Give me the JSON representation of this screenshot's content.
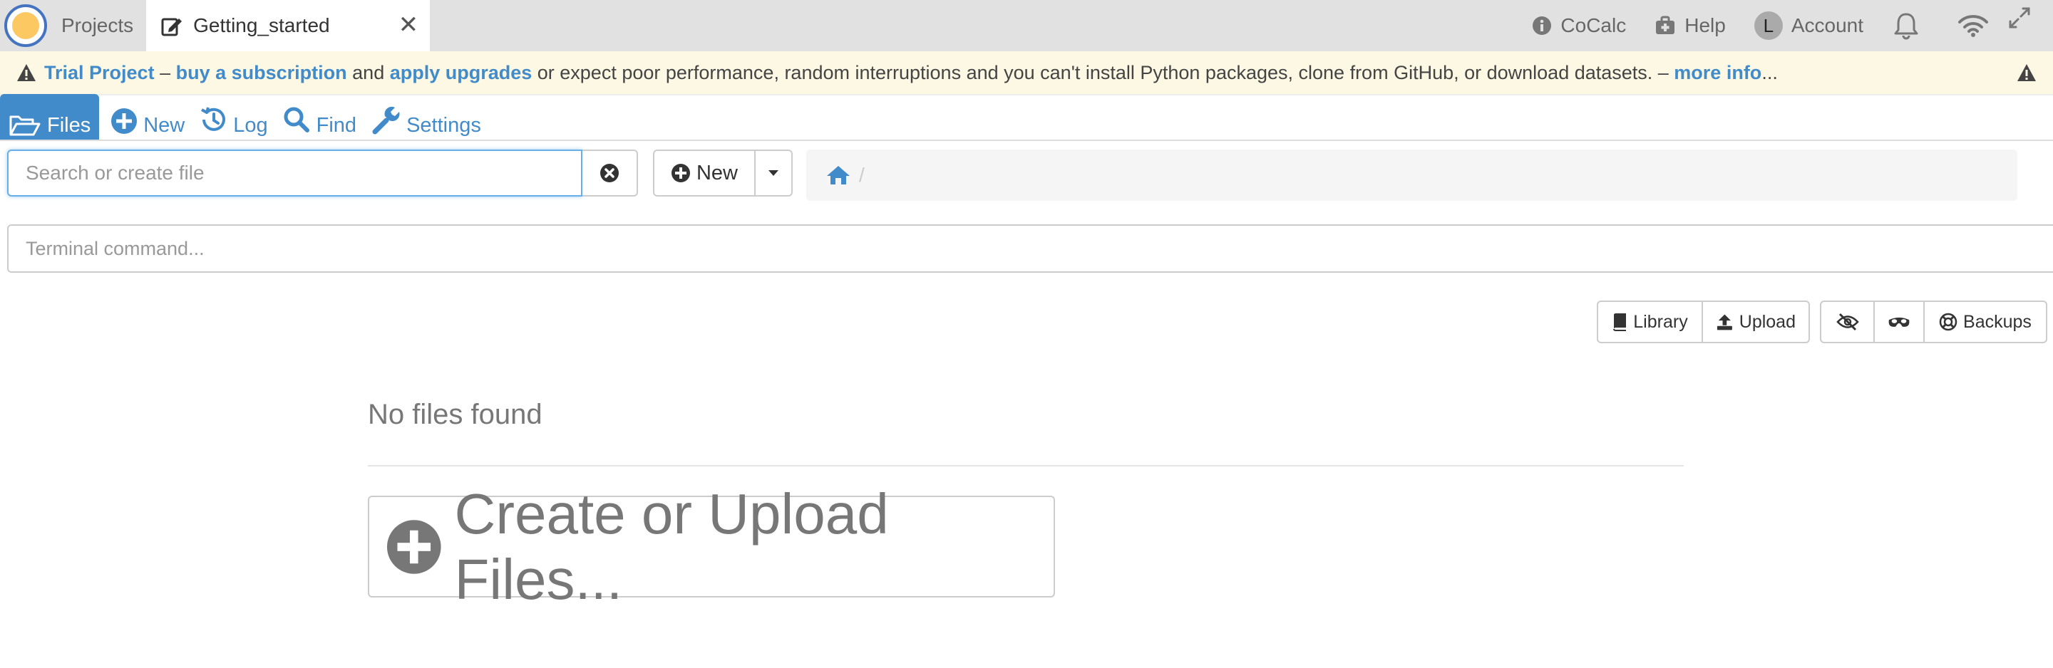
{
  "topbar": {
    "projects_label": "Projects",
    "active_tab_label": "Getting_started",
    "close_glyph": "✕",
    "cocalc_label": "CoCalc",
    "help_label": "Help",
    "account_initial": "L",
    "account_label": "Account"
  },
  "banner": {
    "trial": "Trial Project",
    "dash1": " – ",
    "buy": "buy a subscription",
    "and": " and ",
    "apply": "apply upgrades",
    "rest": " or expect poor performance, random interruptions and you can't install Python packages, clone from GitHub, or download datasets. – ",
    "more": "more info",
    "ellipsis": "..."
  },
  "nav": {
    "files": "Files",
    "new": "New",
    "log": "Log",
    "find": "Find",
    "settings": "Settings"
  },
  "search": {
    "placeholder": "Search or create file",
    "value": ""
  },
  "new_button": {
    "label": "New"
  },
  "breadcrumb": {
    "separator": "/"
  },
  "terminal": {
    "placeholder": "Terminal command..."
  },
  "actions": {
    "library": "Library",
    "upload": "Upload",
    "backups": "Backups"
  },
  "empty_state": {
    "message": "No files found",
    "create_label": "Create or Upload Files..."
  },
  "colors": {
    "accent": "#428bca",
    "banner_bg": "#fcf8e3",
    "topbar_bg": "#e1e1e1",
    "logo_orange": "#fcc861"
  }
}
